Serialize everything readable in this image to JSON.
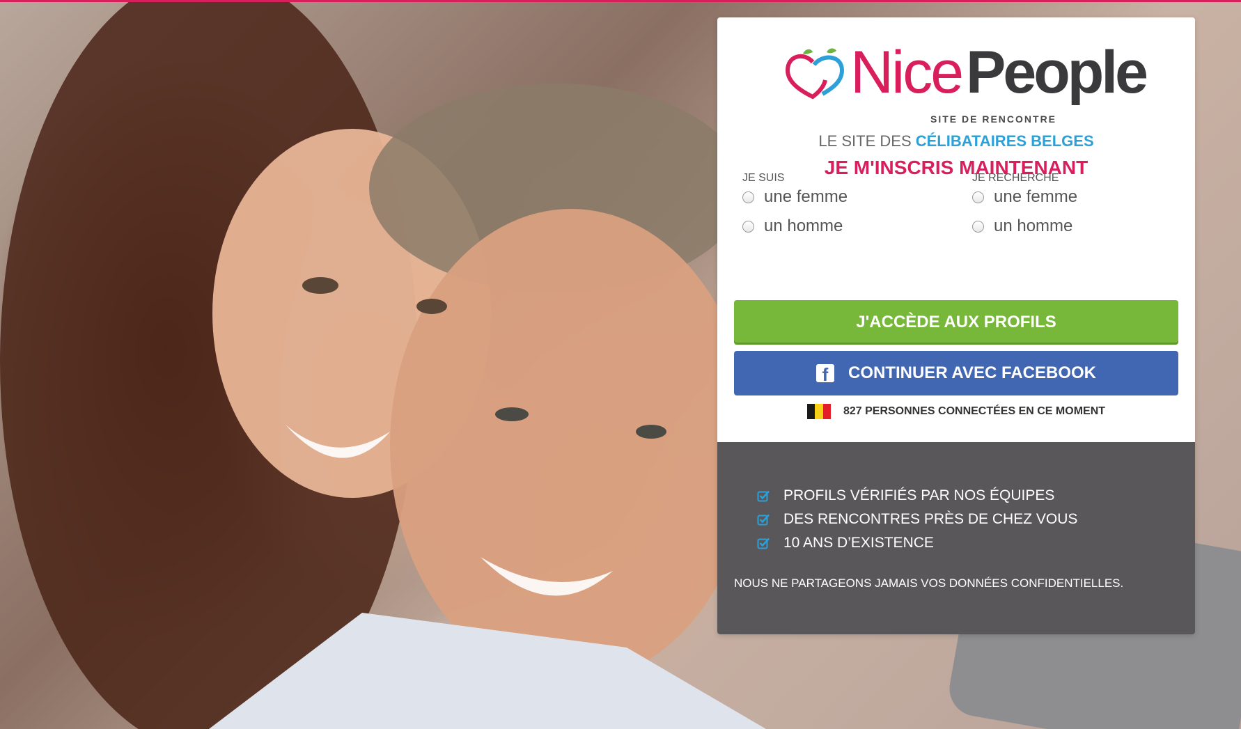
{
  "logo": {
    "brand_part1": "Nice",
    "brand_part2": "People",
    "subtitle": "SITE DE RENCONTRE"
  },
  "tagline": {
    "prefix": "LE SITE DES ",
    "highlight": "CÉLIBATAIRES BELGES"
  },
  "headline": "JE M'INSCRIS MAINTENANT",
  "form": {
    "i_am": {
      "label": "JE SUIS",
      "options": [
        "une femme",
        "un homme"
      ]
    },
    "seeking": {
      "label": "JE RECHERCHE",
      "options": [
        "une femme",
        "un homme"
      ]
    }
  },
  "buttons": {
    "access_profiles": "J'ACCÈDE AUX PROFILS",
    "facebook": "CONTINUER AVEC FACEBOOK",
    "facebook_icon": "f"
  },
  "online": {
    "flag": "belgium-flag",
    "text": "827 PERSONNES CONNECTÉES EN CE MOMENT"
  },
  "features": [
    "PROFILS VÉRIFIÉS PAR NOS ÉQUIPES",
    "DES RENCONTRES PRÈS DE CHEZ VOUS",
    "10 ANS D’EXISTENCE"
  ],
  "privacy": "NOUS NE PARTAGEONS JAMAIS VOS DONNÉES CONFIDENTIELLES.",
  "colors": {
    "brand_pink": "#d81e5b",
    "brand_blue": "#2da0d8",
    "green_button": "#77b73a",
    "facebook_blue": "#4267b2",
    "dark_panel": "#59575a"
  }
}
